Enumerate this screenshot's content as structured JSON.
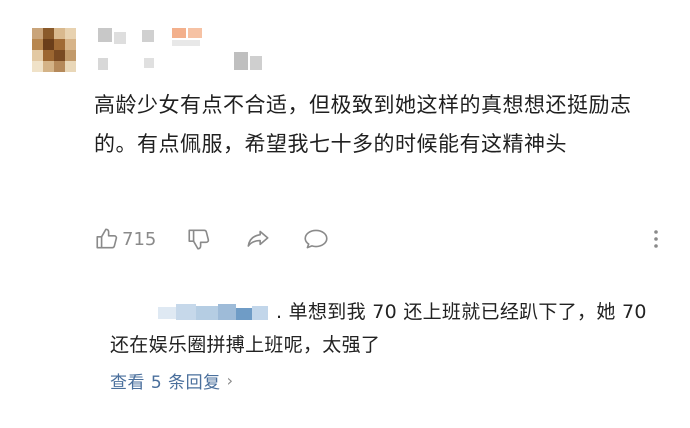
{
  "comment": {
    "text": "高龄少女有点不合适，但极致到她这样的真想想还挺励志的。有点佩服，希望我七十多的时候能有这精神头",
    "like_count": "715"
  },
  "actions": {
    "like_icon": "thumb-up-icon",
    "dislike_icon": "thumb-down-icon",
    "share_icon": "share-icon",
    "reply_icon": "comment-bubble-icon",
    "more_icon": "more-vertical-icon"
  },
  "reply": {
    "text": ". 单想到我 70 还上班就已经趴下了，她 70 还在娱乐圈拼搏上班呢，太强了"
  },
  "view_replies": {
    "label": "查看 5 条回复",
    "chevron": "›"
  },
  "colors": {
    "text": "#1f1f1f",
    "secondary": "#8a8a8a",
    "link": "#4a6f9c",
    "background": "#ffffff"
  }
}
